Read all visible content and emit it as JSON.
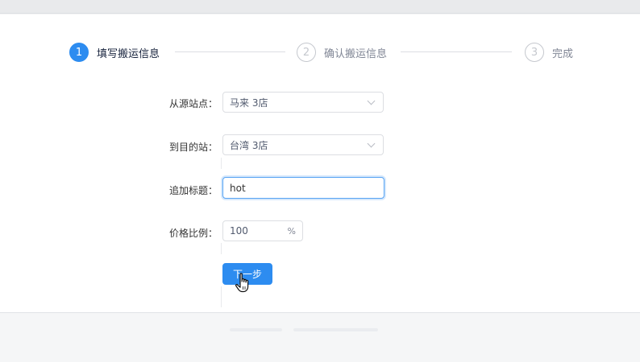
{
  "steps": [
    {
      "number": "1",
      "label": "填写搬运信息",
      "state": "active"
    },
    {
      "number": "2",
      "label": "确认搬运信息",
      "state": "pending"
    },
    {
      "number": "3",
      "label": "完成",
      "state": "pending"
    }
  ],
  "form": {
    "source_label": "从源站点：",
    "source_value": "马来 3店",
    "target_label": "到目的站：",
    "target_value": "台湾 3店",
    "title_label": "追加标题：",
    "title_value": "hot",
    "price_label": "价格比例：",
    "price_value": "100",
    "price_suffix": "%",
    "next_button": "下一步"
  },
  "colors": {
    "primary": "#2d8cf0",
    "step_inactive": "#c5c8ce"
  },
  "icons": {
    "select_arrow": "chevron-down-icon",
    "cursor": "hand-pointer-icon"
  }
}
